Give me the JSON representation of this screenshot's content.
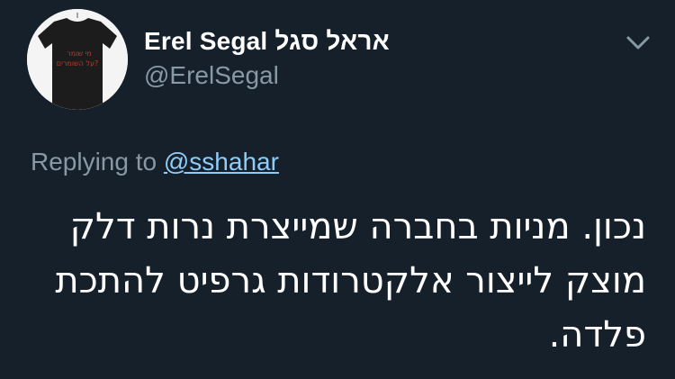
{
  "author": {
    "display_name": "Erel Segal אראל סגל",
    "handle": "@ErelSegal",
    "avatar": {
      "shirt_text_line1": "מי שומר",
      "shirt_text_line2": "על השומרים?"
    }
  },
  "reply": {
    "prefix": "Replying to",
    "mention": "@sshahar"
  },
  "tweet": {
    "text": "נכון. מניות בחברה שמייצרת נרות דלק מוצק לייצור אלקטרודות גרפיט להתכת פלדה."
  },
  "icons": {
    "menu": "chevron-down-icon"
  },
  "colors": {
    "background": "#15202b",
    "secondary_text": "#8899a6",
    "link": "#8ecdf8"
  }
}
